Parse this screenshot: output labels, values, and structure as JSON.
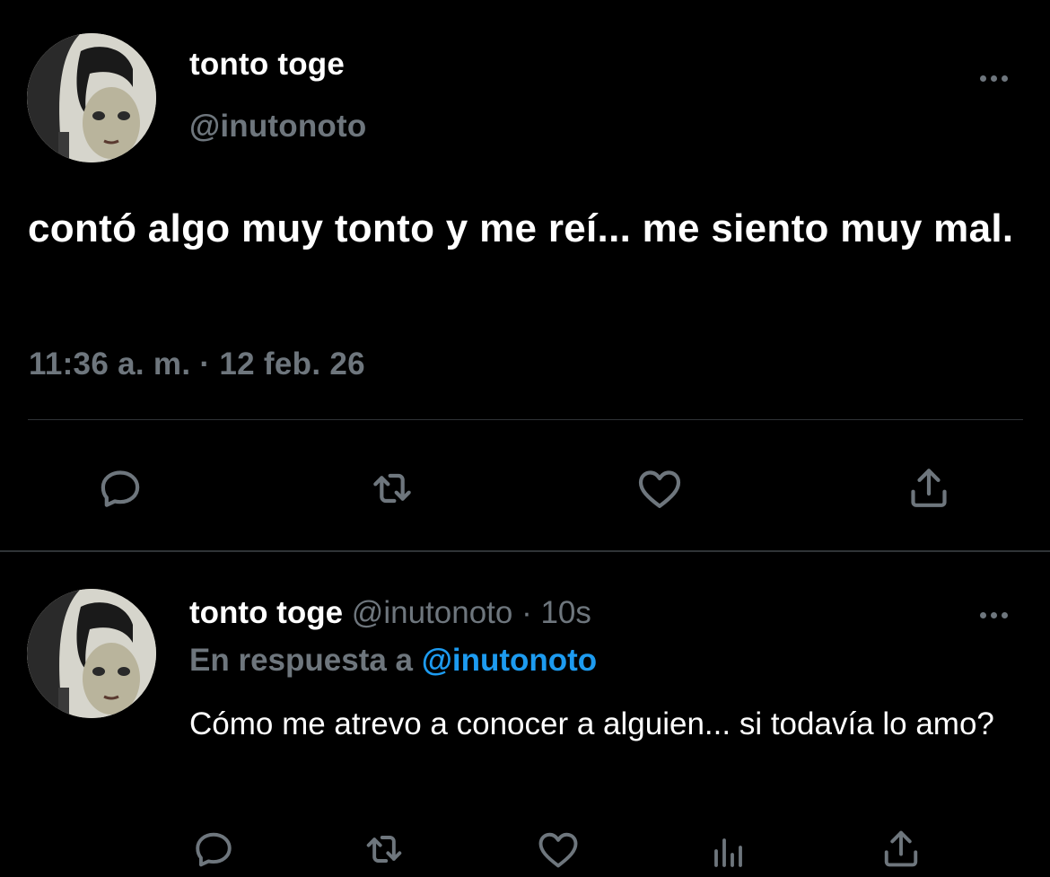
{
  "main_tweet": {
    "display_name": "tonto toge",
    "handle": "@inutonoto",
    "text": "contó algo muy tonto y me reí... me siento muy mal.",
    "timestamp": "11:36 a. m. · 12 feb. 26",
    "actions": [
      "reply-icon",
      "retweet-icon",
      "like-icon",
      "share-icon"
    ]
  },
  "reply_tweet": {
    "display_name": "tonto toge",
    "handle": "@inutonoto",
    "separator": "·",
    "age": "10s",
    "reply_prefix": "En respuesta a",
    "reply_mention": "@inutonoto",
    "text": "Cómo me atrevo a conocer a alguien... si todavía lo amo?",
    "actions": [
      "reply-icon",
      "retweet-icon",
      "like-icon",
      "analytics-icon",
      "share-icon"
    ]
  },
  "colors": {
    "background": "#000000",
    "primary_text": "#ffffff",
    "secondary_text": "#6e767d",
    "accent": "#1d9bf0",
    "divider": "#2f3336"
  }
}
